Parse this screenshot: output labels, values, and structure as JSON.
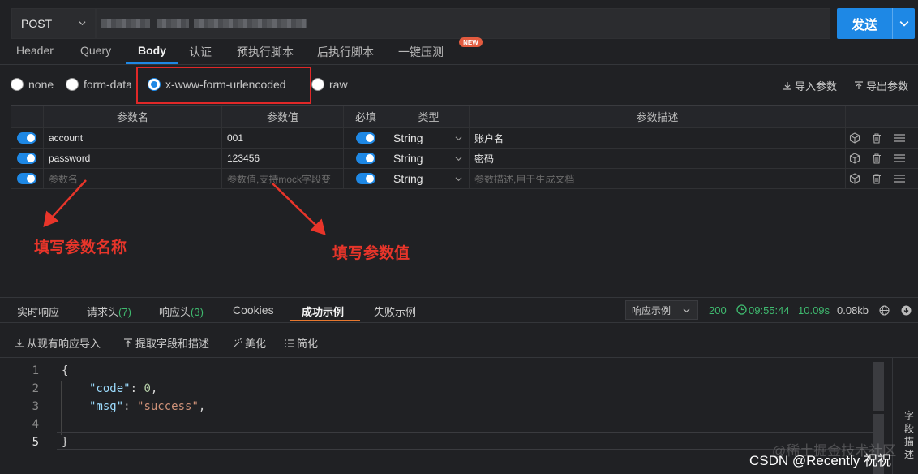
{
  "request": {
    "method": "POST",
    "send_label": "发送"
  },
  "tabs": [
    {
      "label": "Header"
    },
    {
      "label": "Query"
    },
    {
      "label": "Body"
    },
    {
      "label": "认证"
    },
    {
      "label": "预执行脚本"
    },
    {
      "label": "后执行脚本"
    },
    {
      "label": "一键压测"
    }
  ],
  "new_badge": "NEW",
  "body_types": [
    {
      "label": "none"
    },
    {
      "label": "form-data"
    },
    {
      "label": "x-www-form-urlencoded"
    },
    {
      "label": "raw"
    }
  ],
  "import_params": "导入参数",
  "export_params": "导出参数",
  "param_table": {
    "headers": [
      "参数名",
      "参数值",
      "必填",
      "类型",
      "参数描述"
    ],
    "rows": [
      {
        "name": "account",
        "value": "001",
        "type": "String",
        "desc": "账户名"
      },
      {
        "name": "password",
        "value": "123456",
        "type": "String",
        "desc": "密码"
      }
    ],
    "new_row": {
      "name_placeholder": "参数名",
      "value_placeholder": "参数值,支持mock字段变",
      "type": "String",
      "desc_placeholder": "参数描述,用于生成文档"
    }
  },
  "annotations": {
    "name_hint": "填写参数名称",
    "value_hint": "填写参数值"
  },
  "response_tabs": {
    "realtime": "实时响应",
    "req_headers": "请求头",
    "req_headers_count": "(7)",
    "resp_headers": "响应头",
    "resp_headers_count": "(3)",
    "cookies": "Cookies",
    "success_example": "成功示例",
    "fail_example": "失败示例"
  },
  "response_example_select": "响应示例",
  "status": {
    "code": "200",
    "time": "09:55:44",
    "duration": "10.09s",
    "size": "0.08kb"
  },
  "tools": {
    "import_from_response": "从现有响应导入",
    "extract_fields": "提取字段和描述",
    "beautify": "美化",
    "simplify": "简化"
  },
  "editor": {
    "line_numbers": [
      "1",
      "2",
      "3",
      "4",
      "5"
    ],
    "open_brace": "{",
    "close_brace": "}",
    "code_key": "\"code\"",
    "code_value": "0",
    "msg_key": "\"msg\"",
    "msg_value": "\"success\""
  },
  "side_label": "字段描述",
  "watermark": "@稀土掘金技术社区",
  "csdn_credit": "CSDN @Recently 祝祝"
}
